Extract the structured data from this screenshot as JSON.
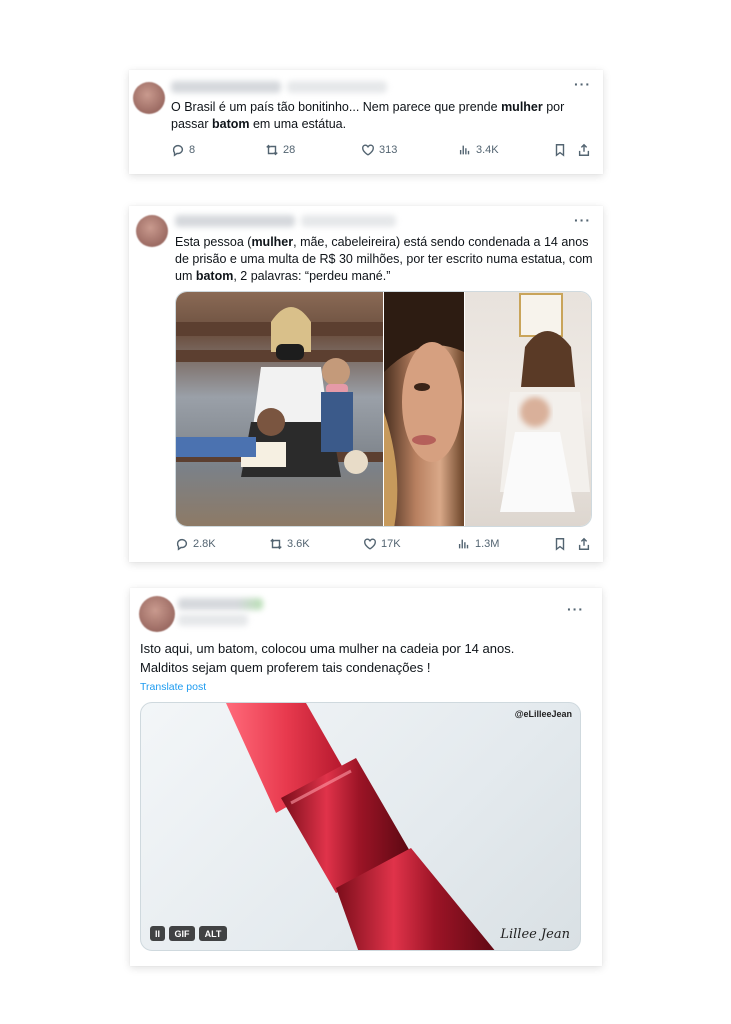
{
  "tweet1": {
    "text_parts": [
      "O Brasil é um país tão bonitinho... Nem parece que prende ",
      "mulher",
      " por passar ",
      "batom",
      " em uma estátua."
    ],
    "replies": "8",
    "reposts": "28",
    "likes": "313",
    "views": "3.4K"
  },
  "tweet2": {
    "text_parts": [
      "Esta pessoa (",
      "mulher",
      ", mãe, cabeleireira) está sendo condenada a 14 anos de prisão e uma multa de R$ 30 milhões, por ter escrito numa estatua, com um ",
      "batom",
      ", 2 palavras: “perdeu mané.”"
    ],
    "replies": "2.8K",
    "reposts": "3.6K",
    "likes": "17K",
    "views": "1.3M"
  },
  "tweet3": {
    "line1": "Isto aqui, um batom, colocou uma mulher na cadeia por 14 anos.",
    "line2": "Malditos sejam quem proferem tais condenações !",
    "translate": "Translate post",
    "gif_label": "GIF",
    "alt_label": "ALT",
    "pause_label": "II",
    "watermark": "@eLilleeJean",
    "signature": "Lillee Jean"
  },
  "icons": [
    "reply-icon",
    "repost-icon",
    "like-icon",
    "views-icon",
    "bookmark-icon",
    "share-icon",
    "more-icon"
  ],
  "colors": {
    "link": "#1d9bf0",
    "muted": "#536471",
    "text": "#0f1419",
    "lipstick": "#d8283a"
  }
}
